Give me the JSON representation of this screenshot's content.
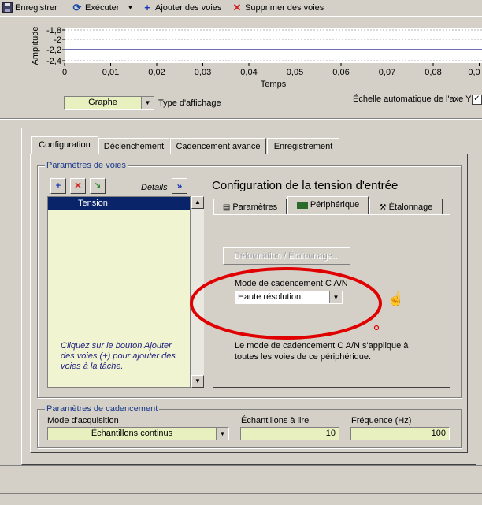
{
  "toolbar": {
    "save": "Enregistrer",
    "run": "Exécuter",
    "add_channels": "Ajouter des voies",
    "remove_channels": "Supprimer des voies"
  },
  "graph": {
    "y_axis_label": "Amplitude",
    "x_axis_label": "Temps",
    "y_ticks": [
      "-1,8",
      "-2",
      "-2,2",
      "-2,4"
    ],
    "x_ticks": [
      "0",
      "0,01",
      "0,02",
      "0,03",
      "0,04",
      "0,05",
      "0,06",
      "0,07",
      "0,08",
      "0,0"
    ],
    "display_type_value": "Graphe",
    "display_type_label": "Type d'affichage",
    "autoscale_label": "Échelle automatique de l'axe Y",
    "autoscale_checked": "✓"
  },
  "tabs": {
    "main": [
      "Configuration",
      "Déclenchement",
      "Cadencement avancé",
      "Enregistrement"
    ],
    "sub": [
      "Paramètres",
      "Périphérique",
      "Étalonnage"
    ]
  },
  "channels": {
    "group_title": "Paramètres de voies",
    "details_label": "Détails",
    "items": [
      "Tension"
    ],
    "hint": "Cliquez sur le bouton Ajouter des voies (+) pour ajouter des voies à la tâche."
  },
  "voltage": {
    "title": "Configuration de la tension d'entrée",
    "disabled_button": "Déformation / Étalonnage...",
    "adc_mode_label": "Mode de cadencement C A/N",
    "adc_mode_value": "Haute résolution",
    "description": "Le mode de cadencement C A/N s'applique à toutes les voies de ce périphérique."
  },
  "timing": {
    "group_title": "Paramètres de cadencement",
    "mode_label": "Mode d'acquisition",
    "mode_value": "Échantillons continus",
    "samples_label": "Échantillons à lire",
    "samples_value": "10",
    "rate_label": "Fréquence (Hz)",
    "rate_value": "100"
  },
  "colors": {
    "field_bg": "#e8f0c0",
    "selection": "#0a246a",
    "annotation": "#e00000",
    "plot_line": "#1a1a8a"
  }
}
